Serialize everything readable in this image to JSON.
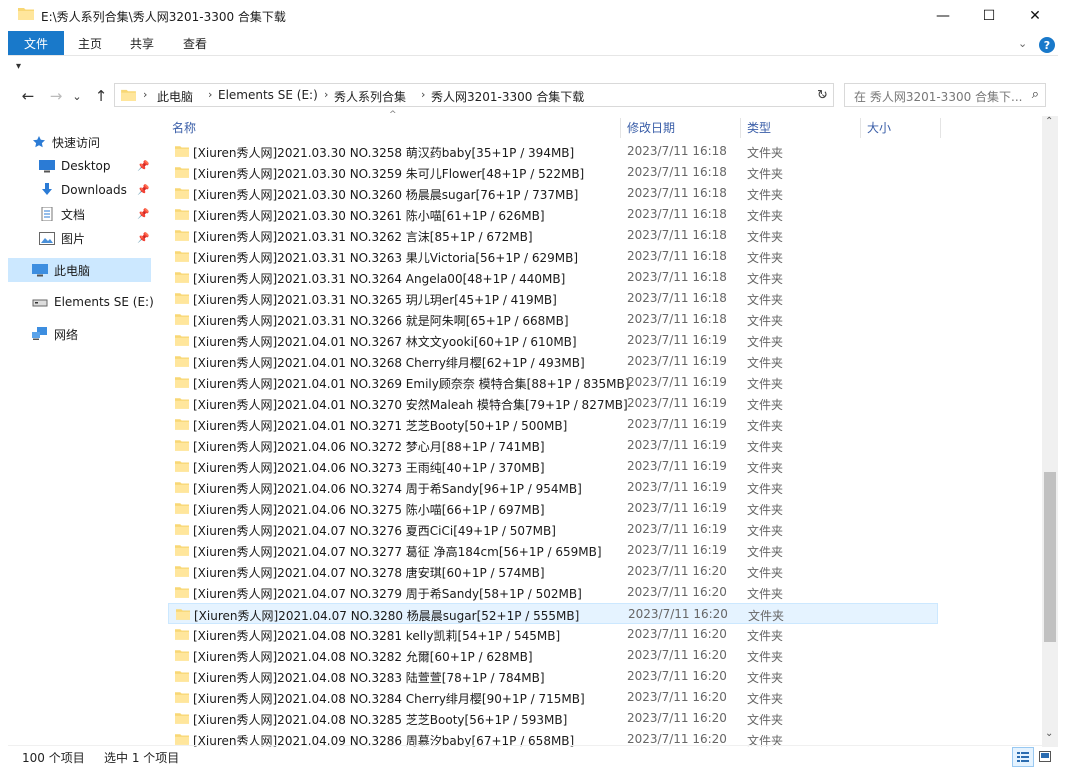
{
  "window": {
    "title": "E:\\秀人系列合集\\秀人网3201-3300 合集下载",
    "controls": {
      "minimize": "—",
      "maximize": "☐",
      "close": "✕"
    }
  },
  "ribbon": {
    "tabs": [
      "文件",
      "主页",
      "共享",
      "查看"
    ],
    "collapse_glyph": "⌄",
    "help_glyph": "?",
    "qat_glyph": "▾"
  },
  "nav": {
    "back": "←",
    "forward": "→",
    "recent": "⌄",
    "up": "↑",
    "breadcrumb": [
      "此电脑",
      "Elements SE (E:)",
      "秀人系列合集",
      "秀人网3201-3300 合集下载"
    ],
    "separator": "›",
    "dropdown": "⌄",
    "refresh": "↻",
    "search_placeholder": "在 秀人网3201-3300 合集下...",
    "search_glyph": "⌕"
  },
  "sidebar": {
    "quick_access": "快速访问",
    "items": [
      {
        "label": "Desktop",
        "icon": "desktop-icon",
        "pinned": true
      },
      {
        "label": "Downloads",
        "icon": "download-icon",
        "pinned": true
      },
      {
        "label": "文档",
        "icon": "document-icon",
        "pinned": true
      },
      {
        "label": "图片",
        "icon": "picture-icon",
        "pinned": true
      }
    ],
    "this_pc": "此电脑",
    "drive": "Elements SE (E:)",
    "network": "网络",
    "pin_glyph": "📌"
  },
  "columns": {
    "name": "名称",
    "date": "修改日期",
    "type": "类型",
    "size": "大小",
    "sort_glyph": "^"
  },
  "files": [
    {
      "name": "[Xiuren秀人网]2021.03.30 NO.3258 萌汉药baby[35+1P / 394MB]",
      "date": "2023/7/11 16:18",
      "type": "文件夹"
    },
    {
      "name": "[Xiuren秀人网]2021.03.30 NO.3259 朱可儿Flower[48+1P / 522MB]",
      "date": "2023/7/11 16:18",
      "type": "文件夹"
    },
    {
      "name": "[Xiuren秀人网]2021.03.30 NO.3260 杨晨晨sugar[76+1P / 737MB]",
      "date": "2023/7/11 16:18",
      "type": "文件夹"
    },
    {
      "name": "[Xiuren秀人网]2021.03.30 NO.3261 陈小喵[61+1P / 626MB]",
      "date": "2023/7/11 16:18",
      "type": "文件夹"
    },
    {
      "name": "[Xiuren秀人网]2021.03.31 NO.3262 言沫[85+1P / 672MB]",
      "date": "2023/7/11 16:18",
      "type": "文件夹"
    },
    {
      "name": "[Xiuren秀人网]2021.03.31 NO.3263 果儿Victoria[56+1P / 629MB]",
      "date": "2023/7/11 16:18",
      "type": "文件夹"
    },
    {
      "name": "[Xiuren秀人网]2021.03.31 NO.3264 Angela00[48+1P / 440MB]",
      "date": "2023/7/11 16:18",
      "type": "文件夹"
    },
    {
      "name": "[Xiuren秀人网]2021.03.31 NO.3265 玥儿玥er[45+1P / 419MB]",
      "date": "2023/7/11 16:18",
      "type": "文件夹"
    },
    {
      "name": "[Xiuren秀人网]2021.03.31 NO.3266 就是阿朱啊[65+1P / 668MB]",
      "date": "2023/7/11 16:18",
      "type": "文件夹"
    },
    {
      "name": "[Xiuren秀人网]2021.04.01 NO.3267 林文文yooki[60+1P / 610MB]",
      "date": "2023/7/11 16:19",
      "type": "文件夹"
    },
    {
      "name": "[Xiuren秀人网]2021.04.01 NO.3268 Cherry绯月樱[62+1P / 493MB]",
      "date": "2023/7/11 16:19",
      "type": "文件夹"
    },
    {
      "name": "[Xiuren秀人网]2021.04.01 NO.3269 Emily顾奈奈 模特合集[88+1P / 835MB]",
      "date": "2023/7/11 16:19",
      "type": "文件夹"
    },
    {
      "name": "[Xiuren秀人网]2021.04.01 NO.3270 安然Maleah 模特合集[79+1P / 827MB]",
      "date": "2023/7/11 16:19",
      "type": "文件夹"
    },
    {
      "name": "[Xiuren秀人网]2021.04.01 NO.3271 芝芝Booty[50+1P / 500MB]",
      "date": "2023/7/11 16:19",
      "type": "文件夹"
    },
    {
      "name": "[Xiuren秀人网]2021.04.06 NO.3272 梦心月[88+1P / 741MB]",
      "date": "2023/7/11 16:19",
      "type": "文件夹"
    },
    {
      "name": "[Xiuren秀人网]2021.04.06 NO.3273 王雨纯[40+1P / 370MB]",
      "date": "2023/7/11 16:19",
      "type": "文件夹"
    },
    {
      "name": "[Xiuren秀人网]2021.04.06 NO.3274 周于希Sandy[96+1P / 954MB]",
      "date": "2023/7/11 16:19",
      "type": "文件夹"
    },
    {
      "name": "[Xiuren秀人网]2021.04.06 NO.3275 陈小喵[66+1P / 697MB]",
      "date": "2023/7/11 16:19",
      "type": "文件夹"
    },
    {
      "name": "[Xiuren秀人网]2021.04.07 NO.3276 夏西CiCi[49+1P / 507MB]",
      "date": "2023/7/11 16:19",
      "type": "文件夹"
    },
    {
      "name": "[Xiuren秀人网]2021.04.07 NO.3277 葛征 净高184cm[56+1P / 659MB]",
      "date": "2023/7/11 16:19",
      "type": "文件夹"
    },
    {
      "name": "[Xiuren秀人网]2021.04.07 NO.3278 唐安琪[60+1P / 574MB]",
      "date": "2023/7/11 16:20",
      "type": "文件夹"
    },
    {
      "name": "[Xiuren秀人网]2021.04.07 NO.3279 周于希Sandy[58+1P / 502MB]",
      "date": "2023/7/11 16:20",
      "type": "文件夹"
    },
    {
      "name": "[Xiuren秀人网]2021.04.07 NO.3280 杨晨晨sugar[52+1P / 555MB]",
      "date": "2023/7/11 16:20",
      "type": "文件夹",
      "selected": true
    },
    {
      "name": "[Xiuren秀人网]2021.04.08 NO.3281 kelly凯莉[54+1P / 545MB]",
      "date": "2023/7/11 16:20",
      "type": "文件夹"
    },
    {
      "name": "[Xiuren秀人网]2021.04.08 NO.3282 允爾[60+1P / 628MB]",
      "date": "2023/7/11 16:20",
      "type": "文件夹"
    },
    {
      "name": "[Xiuren秀人网]2021.04.08 NO.3283 陆萱萱[78+1P / 784MB]",
      "date": "2023/7/11 16:20",
      "type": "文件夹"
    },
    {
      "name": "[Xiuren秀人网]2021.04.08 NO.3284 Cherry绯月樱[90+1P / 715MB]",
      "date": "2023/7/11 16:20",
      "type": "文件夹"
    },
    {
      "name": "[Xiuren秀人网]2021.04.08 NO.3285 芝芝Booty[56+1P / 593MB]",
      "date": "2023/7/11 16:20",
      "type": "文件夹"
    },
    {
      "name": "[Xiuren秀人网]2021.04.09 NO.3286 周慕汐baby[67+1P / 658MB]",
      "date": "2023/7/11 16:20",
      "type": "文件夹"
    }
  ],
  "status": {
    "count": "100 个项目",
    "selection": "选中 1 个项目"
  },
  "scroll": {
    "up": "⌃",
    "down": "⌄"
  },
  "colors": {
    "accent": "#1979ca",
    "selected_row": "#e5f3ff",
    "nav_selected": "#cce8ff",
    "folder": "#f8d775"
  }
}
